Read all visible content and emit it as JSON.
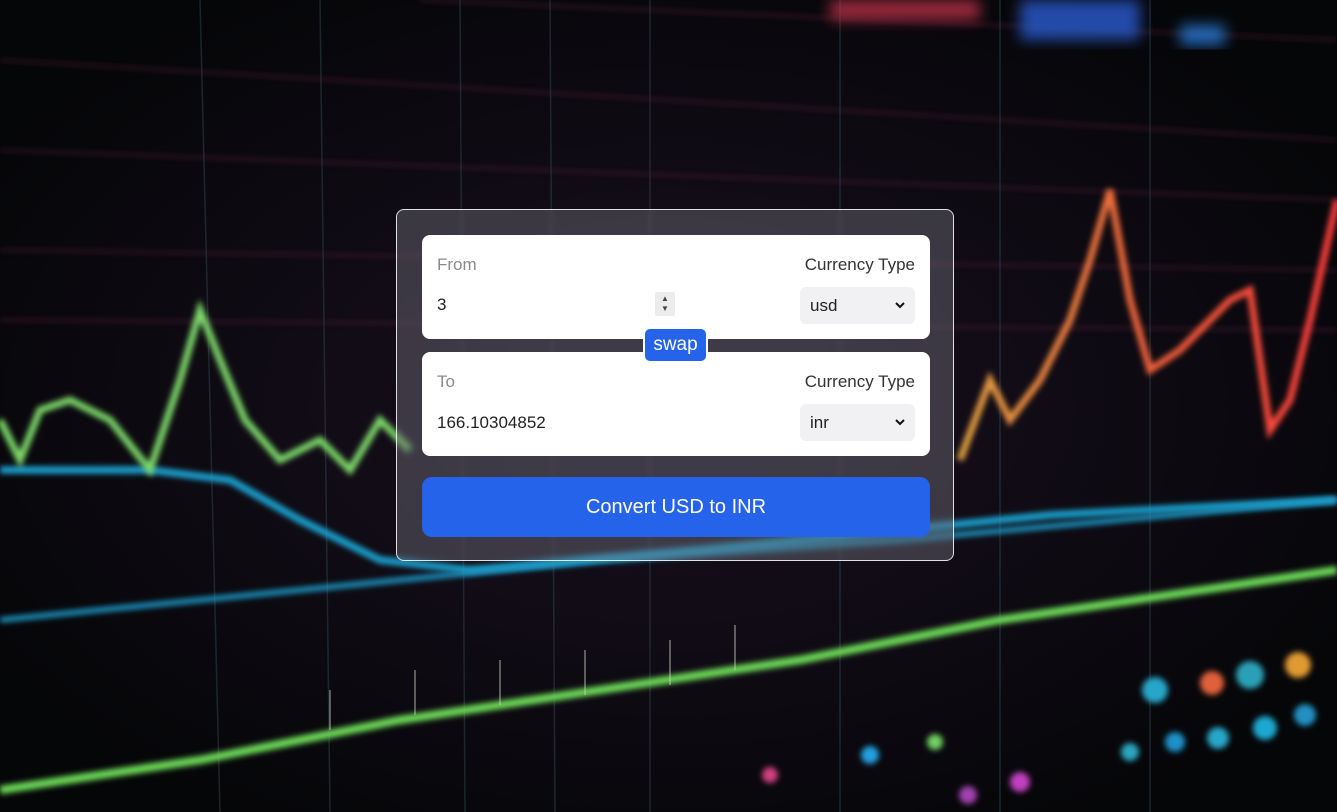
{
  "converter": {
    "from": {
      "label": "From",
      "currency_type_label": "Currency Type",
      "amount": "3",
      "selected_currency": "usd"
    },
    "to": {
      "label": "To",
      "currency_type_label": "Currency Type",
      "amount": "166.10304852",
      "selected_currency": "inr"
    },
    "swap_label": "swap",
    "convert_label": "Convert USD to INR"
  },
  "colors": {
    "accent": "#2563eb",
    "card_border": "#ffffff",
    "background": "#07090d"
  },
  "icons": {
    "select_arrow": "chevron-down-icon",
    "number_spinner": "spinner-arrows-icon"
  }
}
